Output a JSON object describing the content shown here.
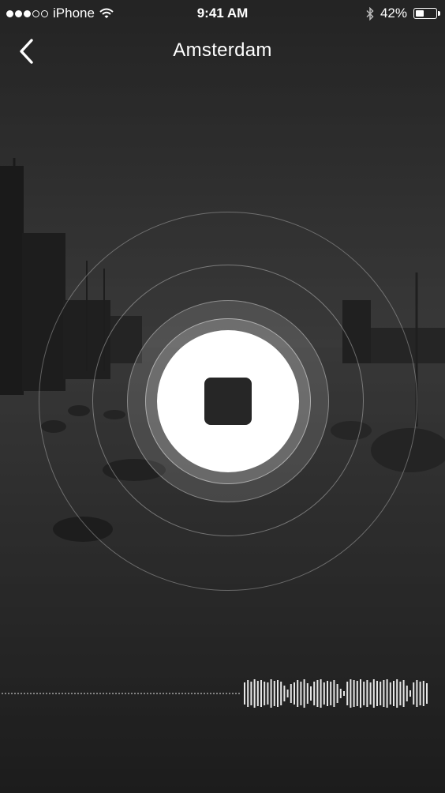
{
  "status_bar": {
    "carrier": "iPhone",
    "time": "9:41 AM",
    "battery": "42%",
    "battery_level": 0.42,
    "signal_strength": 3,
    "signal_max": 5
  },
  "nav": {
    "title": "Amsterdam",
    "back_icon": "chevron-left-icon"
  },
  "recorder": {
    "state": "recording",
    "control_icon": "stop-icon"
  },
  "colors": {
    "overlay": "#2b2b2b",
    "stop_square": "#262626",
    "foreground": "#ffffff"
  }
}
